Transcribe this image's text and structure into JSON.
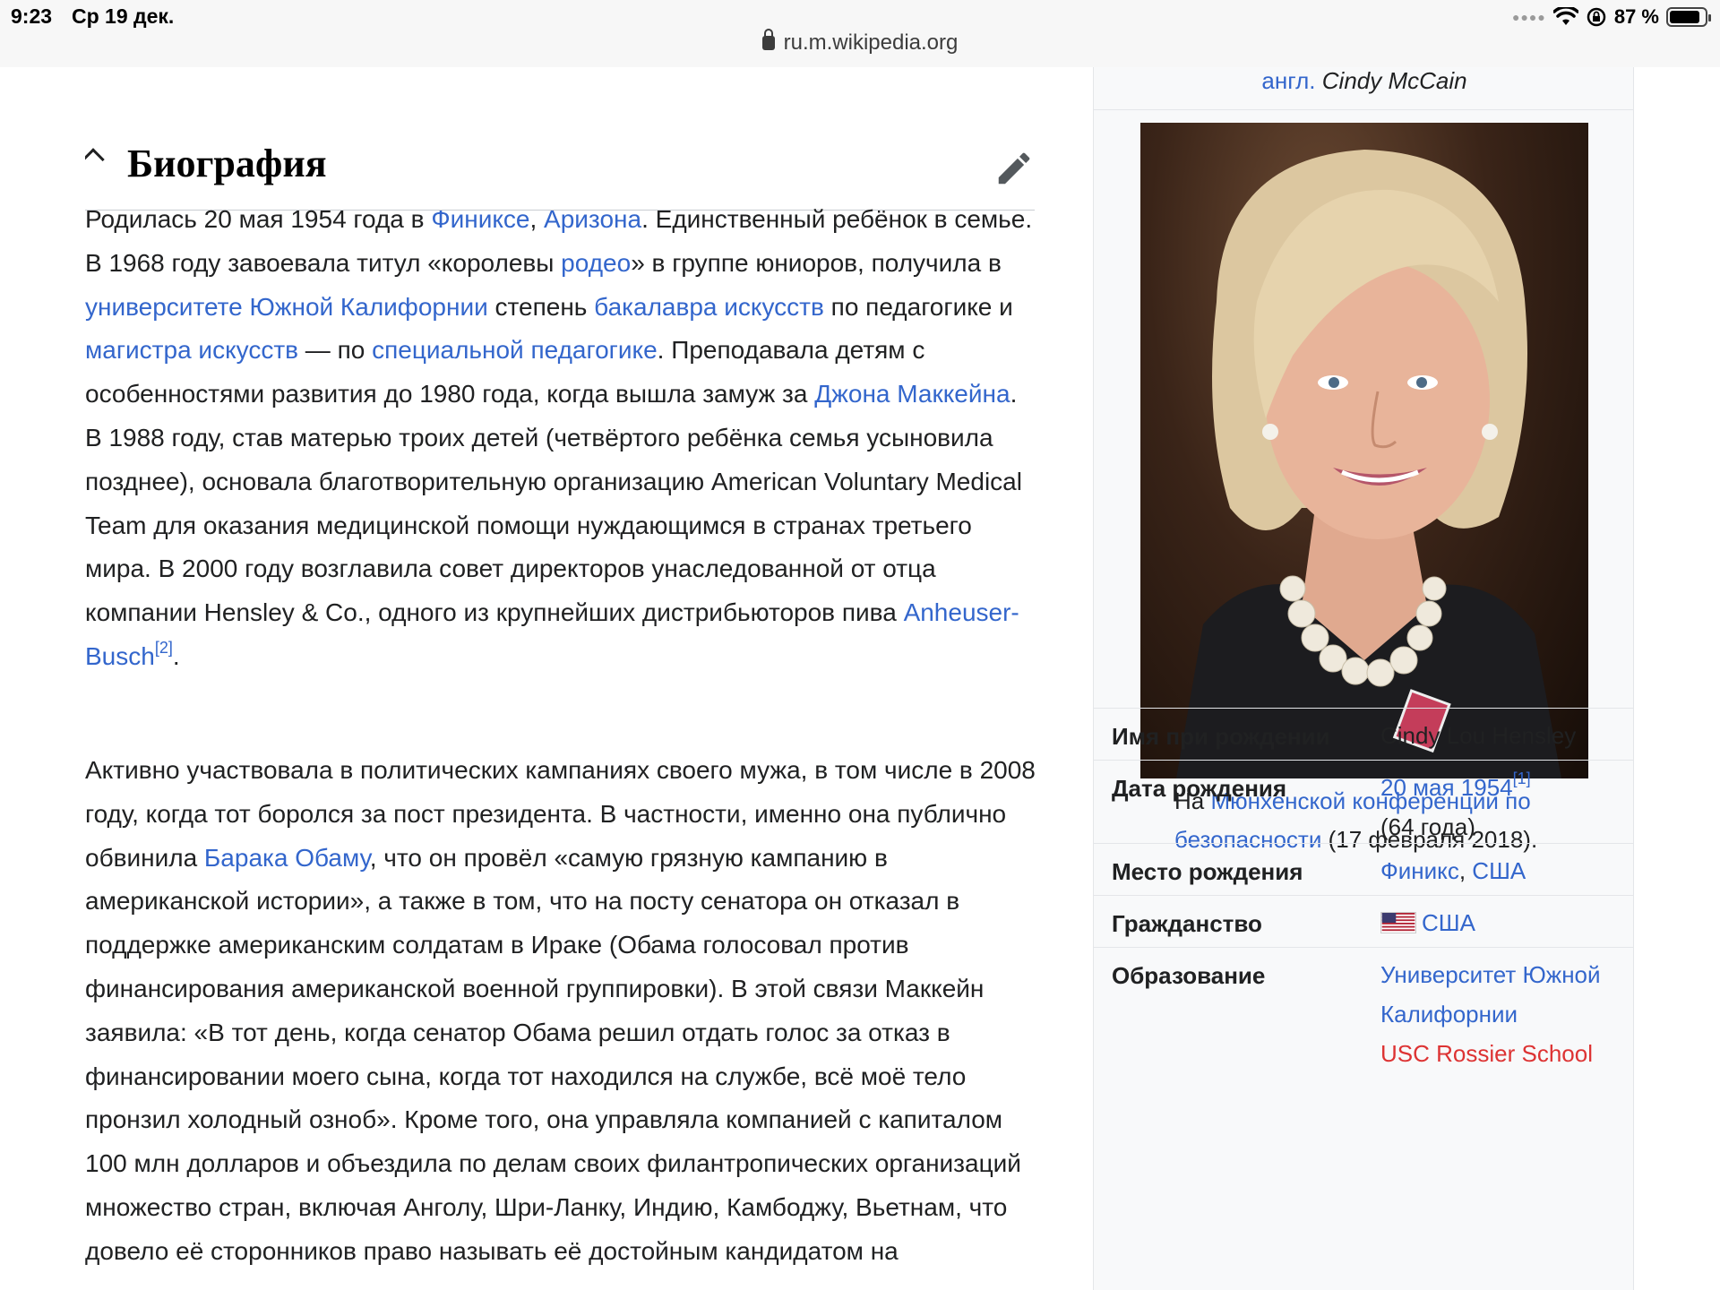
{
  "status_bar": {
    "time": "9:23",
    "date": "Ср 19 дек.",
    "battery": "87 %",
    "battery_level": 0.87,
    "url": "ru.m.wikipedia.org"
  },
  "section": {
    "title": "Биография"
  },
  "paragraph1": {
    "t1": "Родилась 20 мая 1954 года в ",
    "l1": "Финиксе",
    "t2": ", ",
    "l2": "Аризона",
    "t3": ". Единственный ребёнок в семье. В 1968 году завоевала титул «королевы ",
    "l3": "родео",
    "t4": "» в группе юниоров, получила в ",
    "l4": "университете Южной Калифорнии",
    "t5": " степень ",
    "l5": "бакалавра искусств",
    "t6": " по педагогике и ",
    "l6": "магистра искусств",
    "t7": " — по ",
    "l7": "специальной педагогике",
    "t8": ". Преподавала детям с особенностями развития до 1980 года, когда вышла замуж за ",
    "l8": "Джона Маккейна",
    "t9": ". В 1988 году, став матерью троих детей (четвёртого ребёнка семья усыновила позднее), основала благотворительную организацию American Voluntary Medical Team для оказания медицинской помощи нуждающимся в странах третьего мира. В 2000 году возглавила совет директоров унаследованной от отца компании Hensley & Co., одного из крупнейших дистрибьюторов пива ",
    "l9": "Anheuser-Busch",
    "ref": "[2]",
    "t10": "."
  },
  "paragraph2": {
    "t1": "Активно участвовала в политических кампаниях своего мужа, в том числе в 2008 году, когда тот боролся за пост президента. В частности, именно она публично обвинила ",
    "l1": "Барака Обаму",
    "t2": ", что он провёл «самую грязную кампанию в американской истории», а также в том, что на посту сенатора он отказал в поддержке американским солдатам в Ираке (Обама голосовал против финансирования американской военной группировки). В этой связи Маккейн заявила: «В тот день, когда сенатор Обама решил отдать голос за отказ в финансировании моего сына, когда тот находился на службе, всё моё тело пронзил холодный озноб». Кроме того, она управляла компанией с капиталом 100 млн долларов и объездила по делам своих филантропических организаций множество стран, включая Анголу, Шри-Ланку, Индию, Камбоджу, Вьетнам, что довело её сторонников право называть её достойным кандидатом на"
  },
  "infobox": {
    "orig_lang": "англ.",
    "orig_name": "Cindy McCain",
    "caption_prefix": "На ",
    "caption_link": "Мюнхенской конференции по безопасности",
    "caption_suffix": " (17 февраля 2018).",
    "rows": [
      {
        "label": "Имя при рождении",
        "value": "Cindy Lou Hensley"
      },
      {
        "label": "Дата рождения",
        "link": "20 мая 1954",
        "ref": "[1]",
        "value2": "(64 года)"
      },
      {
        "label": "Место рождения",
        "link1": "Финикс",
        "sep": ", ",
        "link2": "США"
      },
      {
        "label": "Гражданство",
        "link": "США"
      },
      {
        "label": "Образование",
        "link": "Университет Южной Калифорнии",
        "link_red": "USC Rossier School"
      }
    ]
  },
  "colors": {
    "link": "#3366cc",
    "redlink": "#dd3333",
    "infobox_bg": "#f8f9fa",
    "text": "#202122"
  },
  "icons": [
    "lock-icon",
    "wifi-icon",
    "orientation-lock-icon",
    "battery-icon",
    "chevron-up-icon",
    "pencil-edit-icon",
    "us-flag-icon"
  ]
}
